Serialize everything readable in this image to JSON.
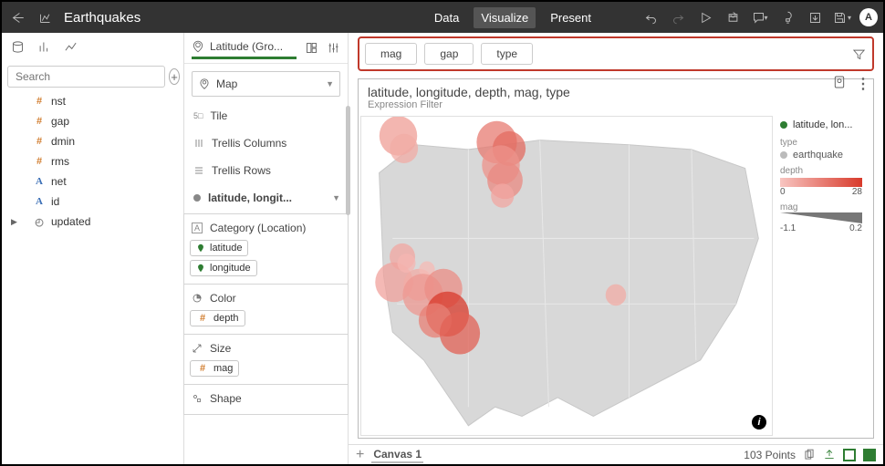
{
  "header": {
    "title": "Earthquakes",
    "tabs": {
      "data": "Data",
      "visualize": "Visualize",
      "present": "Present"
    },
    "avatar": "A"
  },
  "datapanel": {
    "search_placeholder": "Search",
    "fields": [
      {
        "icon": "hash",
        "name": "nst"
      },
      {
        "icon": "hash",
        "name": "gap"
      },
      {
        "icon": "hash",
        "name": "dmin"
      },
      {
        "icon": "hash",
        "name": "rms"
      },
      {
        "icon": "A",
        "name": "net"
      },
      {
        "icon": "A",
        "name": "id"
      },
      {
        "icon": "clock",
        "name": "updated",
        "expandable": true
      }
    ]
  },
  "grammar": {
    "tab_label": "Latitude (Gro...",
    "viz_label": "Map",
    "shelves": {
      "tile": "Tile",
      "trellis_columns": "Trellis Columns",
      "trellis_rows": "Trellis Rows"
    },
    "layer": "latitude, longit...",
    "category_label": "Category (Location)",
    "cat_pill1": "latitude",
    "cat_pill2": "longitude",
    "color_label": "Color",
    "color_pill": "depth",
    "size_label": "Size",
    "size_pill": "mag",
    "shape_label": "Shape"
  },
  "filters": {
    "chips": [
      "mag",
      "gap",
      "type"
    ]
  },
  "viz": {
    "title": "latitude, longitude, depth, mag, type",
    "subtitle": "Expression Filter"
  },
  "legend": {
    "layer": "latitude, lon...",
    "type_label": "type",
    "type_value": "earthquake",
    "depth_label": "depth",
    "depth_min": "0",
    "depth_max": "28",
    "mag_label": "mag",
    "mag_min": "-1.1",
    "mag_max": "0.2"
  },
  "footer": {
    "canvas": "Canvas 1",
    "status": "103 Points"
  },
  "chart_data": {
    "type": "scatter",
    "note": "Bubble map. x≈longitude, y≈latitude, size∝mag, fill∝depth. Values approximated from figure.",
    "points": [
      {
        "lon": -123.5,
        "lat": 48.5,
        "mag": 0.0,
        "depth": 8
      },
      {
        "lon": -122.8,
        "lat": 47.5,
        "mag": -0.4,
        "depth": 5
      },
      {
        "lon": -111.5,
        "lat": 48.0,
        "mag": 0.1,
        "depth": 15
      },
      {
        "lon": -110.0,
        "lat": 47.5,
        "mag": -0.2,
        "depth": 18
      },
      {
        "lon": -111.0,
        "lat": 46.2,
        "mag": 0.0,
        "depth": 10
      },
      {
        "lon": -110.5,
        "lat": 45.0,
        "mag": -0.1,
        "depth": 12
      },
      {
        "lon": -110.8,
        "lat": 43.8,
        "mag": -0.6,
        "depth": 6
      },
      {
        "lon": -123.0,
        "lat": 39.0,
        "mag": -0.5,
        "depth": 6
      },
      {
        "lon": -124.0,
        "lat": 37.0,
        "mag": 0.0,
        "depth": 7
      },
      {
        "lon": -122.5,
        "lat": 38.5,
        "mag": -0.8,
        "depth": 3
      },
      {
        "lon": -121.0,
        "lat": 36.8,
        "mag": -0.3,
        "depth": 5
      },
      {
        "lon": -120.0,
        "lat": 38.0,
        "mag": -0.9,
        "depth": 2
      },
      {
        "lon": -120.5,
        "lat": 36.0,
        "mag": 0.1,
        "depth": 9
      },
      {
        "lon": -118.0,
        "lat": 36.5,
        "mag": 0.0,
        "depth": 11
      },
      {
        "lon": -117.5,
        "lat": 34.5,
        "mag": 0.2,
        "depth": 28
      },
      {
        "lon": -119.0,
        "lat": 34.0,
        "mag": -0.2,
        "depth": 14
      },
      {
        "lon": -116.0,
        "lat": 33.0,
        "mag": 0.1,
        "depth": 20
      },
      {
        "lon": -97.0,
        "lat": 36.0,
        "mag": -0.7,
        "depth": 5
      }
    ],
    "color_scale": {
      "field": "depth",
      "min": 0,
      "max": 28
    },
    "size_scale": {
      "field": "mag",
      "min": -1.1,
      "max": 0.2
    }
  }
}
